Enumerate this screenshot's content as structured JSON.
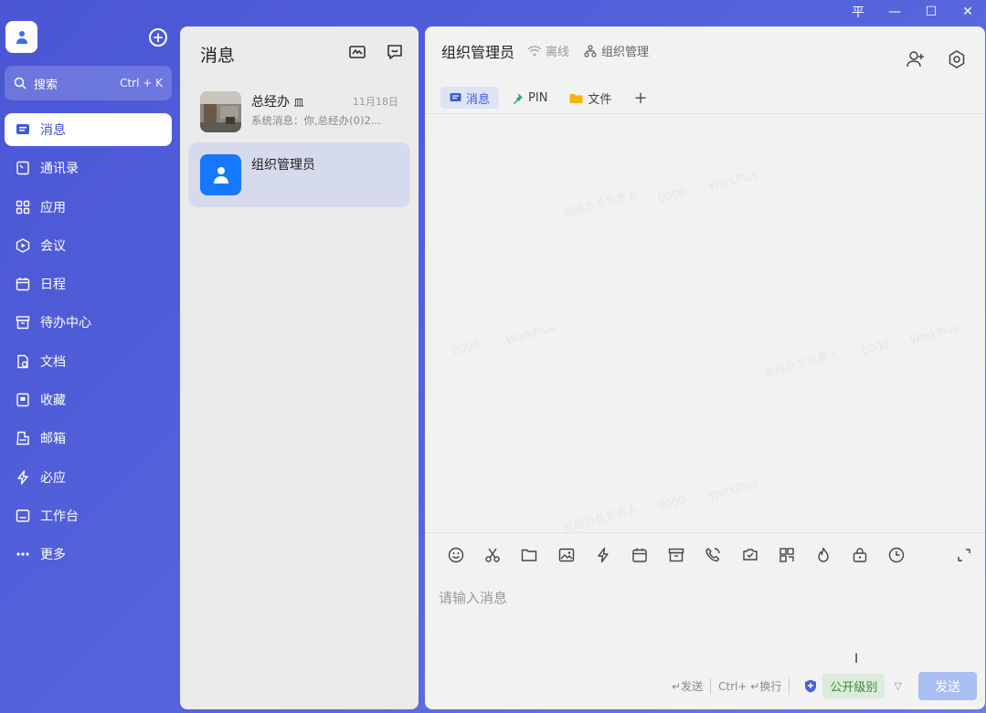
{
  "window": {
    "pin": "平",
    "minimize": "—",
    "maximize": "☐",
    "close": "✕"
  },
  "search": {
    "placeholder": "搜索",
    "shortcut": "Ctrl + K"
  },
  "nav": [
    {
      "label": "消息",
      "icon": "message-icon",
      "active": true
    },
    {
      "label": "通讯录",
      "icon": "contacts-icon"
    },
    {
      "label": "应用",
      "icon": "apps-icon"
    },
    {
      "label": "会议",
      "icon": "meeting-icon"
    },
    {
      "label": "日程",
      "icon": "calendar-icon"
    },
    {
      "label": "待办中心",
      "icon": "todo-icon"
    },
    {
      "label": "文档",
      "icon": "document-icon"
    },
    {
      "label": "收藏",
      "icon": "favorite-icon"
    },
    {
      "label": "邮箱",
      "icon": "mail-icon"
    },
    {
      "label": "必应",
      "icon": "lightning-icon"
    },
    {
      "label": "工作台",
      "icon": "workbench-icon"
    },
    {
      "label": "更多",
      "icon": "more-icon"
    }
  ],
  "list": {
    "title": "消息",
    "conversations": [
      {
        "name": "总经办",
        "badge": "皿",
        "time": "11月18日",
        "preview": "系统消息：你,总经办(0)2..."
      },
      {
        "name": "组织管理员",
        "time": "",
        "preview": ""
      }
    ]
  },
  "chat": {
    "title": "组织管理员",
    "status": "离线",
    "org": "组织管理",
    "tabs": [
      {
        "label": "消息",
        "icon": "message-icon"
      },
      {
        "label": "PIN",
        "icon": "pin-icon"
      },
      {
        "label": "文件",
        "icon": "folder-icon"
      }
    ],
    "add_tab": "+",
    "watermark": [
      "总经办总负责人",
      "0000",
      "WorkPlus"
    ],
    "input_placeholder": "请输入消息",
    "footer": {
      "send_hint": "↵发送",
      "newline_hint": "Ctrl+ ↵换行",
      "level": "公开级别"
    },
    "send_label": "发送"
  },
  "colors": {
    "accent": "#3b5bd6",
    "send_btn": "#a9bff2"
  }
}
